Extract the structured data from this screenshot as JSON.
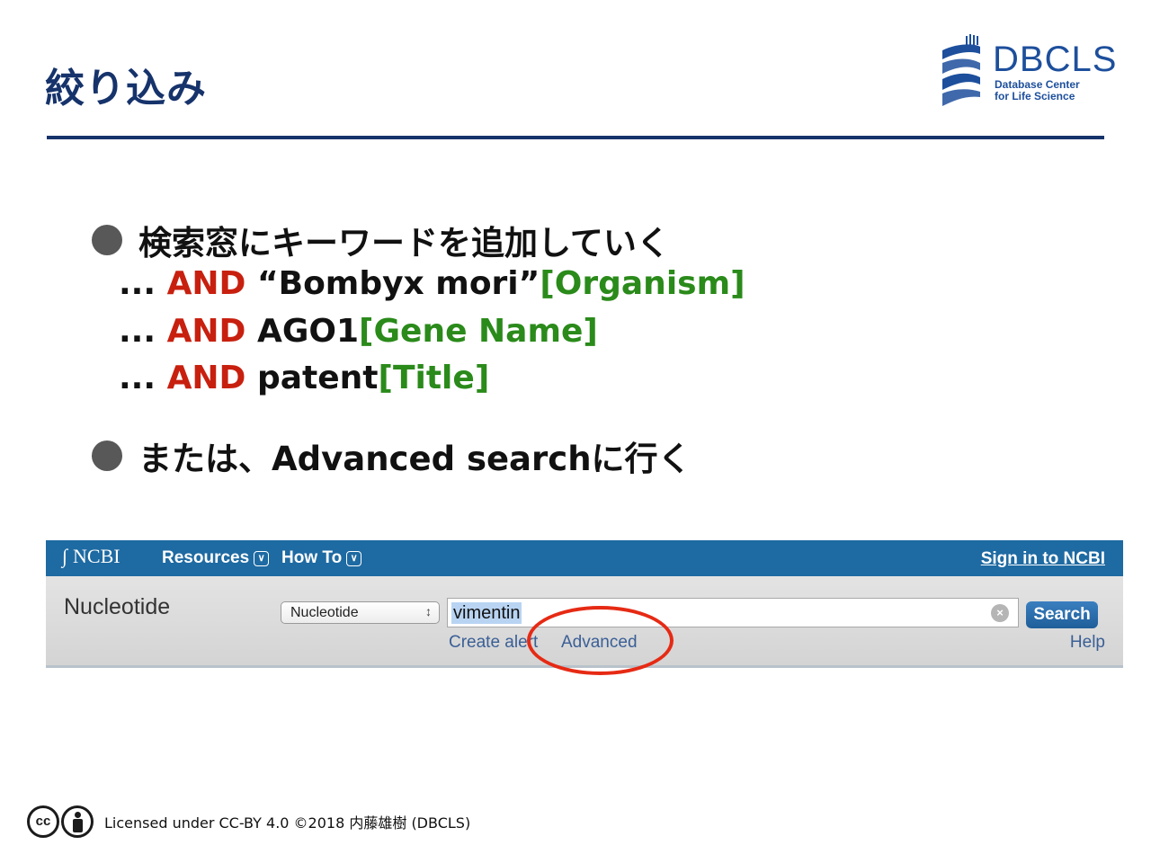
{
  "slide": {
    "title": "絞り込み",
    "logo": {
      "name": "DBCLS",
      "subtitle_line1": "Database Center",
      "subtitle_line2": "for Life Science"
    },
    "bullets": [
      "検索窓にキーワードを追加していく",
      "または、Advanced searchに行く"
    ],
    "queries": [
      {
        "prefix": "...",
        "op": "AND",
        "term": "“Bombyx mori”",
        "field": "[Organism]"
      },
      {
        "prefix": "...",
        "op": "AND",
        "term": "AGO1",
        "field": "[Gene Name]"
      },
      {
        "prefix": "...",
        "op": "AND",
        "term": "patent",
        "field": "[Title]"
      }
    ],
    "colors": {
      "title": "#16336b",
      "and_keyword": "#c8200f",
      "field_tag": "#2a8a1a",
      "highlight_ellipse": "#e62a14"
    }
  },
  "ncbi": {
    "logo": "NCBI",
    "menu": {
      "resources": "Resources",
      "how_to": "How To"
    },
    "sign_in": "Sign in to NCBI",
    "database_title": "Nucleotide",
    "db_select_value": "Nucleotide",
    "search_value": "vimentin",
    "search_button": "Search",
    "links": {
      "create_alert": "Create alert",
      "advanced": "Advanced",
      "help": "Help"
    }
  },
  "footer": {
    "cc_label": "cc",
    "license": "Licensed under CC-BY 4.0 ©2018 内藤雄樹 (DBCLS)"
  }
}
